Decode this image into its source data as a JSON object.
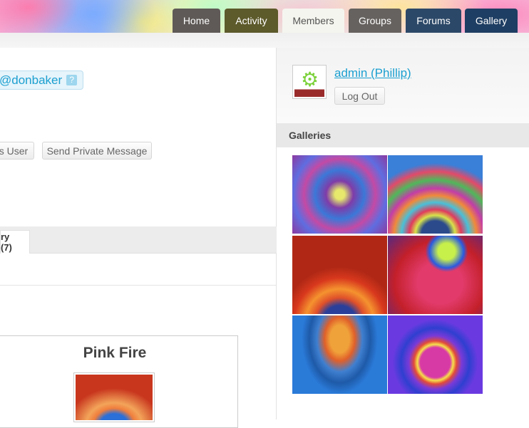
{
  "nav": {
    "home": "Home",
    "activity": "Activity",
    "members": "Members",
    "groups": "Groups",
    "forums": "Forums",
    "gallery": "Gallery"
  },
  "member": {
    "mention": "@donbaker",
    "help_icon": "?",
    "button_user": "s User",
    "button_pm": "Send Private Message",
    "tab_label": "ry (7)"
  },
  "card": {
    "title": "Pink Fire"
  },
  "sidebar": {
    "user_link": "admin (Phillip)",
    "logout": "Log Out",
    "galleries_heading": "Galleries"
  }
}
